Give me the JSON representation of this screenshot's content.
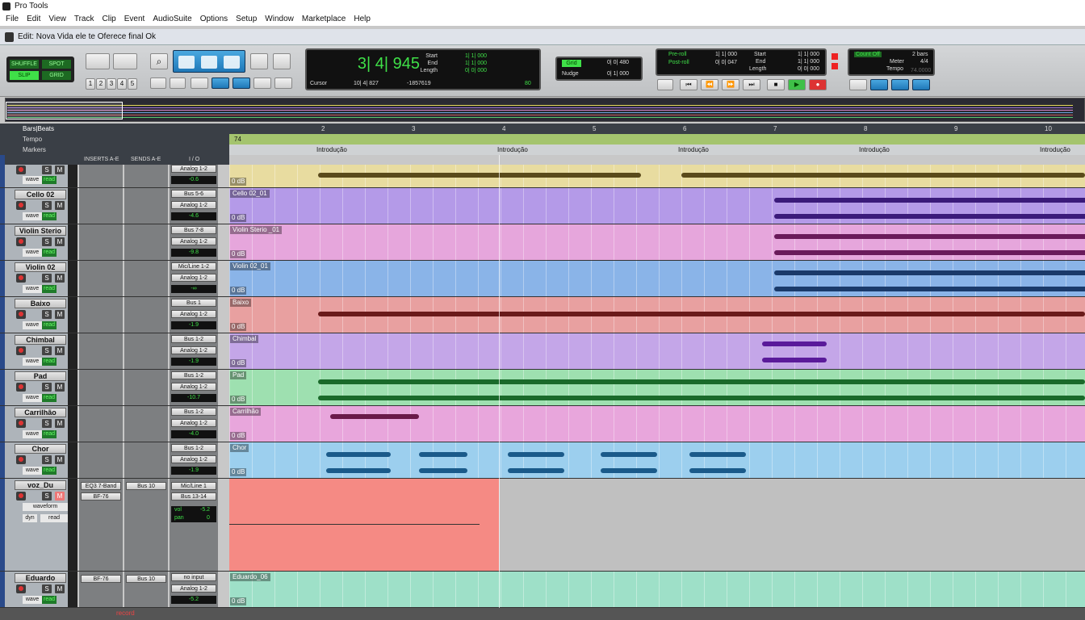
{
  "app": {
    "title": "Pro Tools"
  },
  "menu": [
    "File",
    "Edit",
    "View",
    "Track",
    "Clip",
    "Event",
    "AudioSuite",
    "Options",
    "Setup",
    "Window",
    "Marketplace",
    "Help"
  ],
  "edit_window": {
    "title": "Edit: Nova Vida ele te Oferece final  Ok"
  },
  "toolbar": {
    "modes": {
      "shuffle": "SHUFFLE",
      "spot": "SPOT",
      "slip": "SLIP",
      "grid": "GRID"
    },
    "zoom_presets": [
      "1",
      "2",
      "3",
      "4",
      "5"
    ],
    "counter": {
      "main": "3| 4| 945",
      "cursor_label": "Cursor",
      "cursor_value": "10| 4| 827",
      "sample_value": "-1857619",
      "tempo_small": "80"
    },
    "selection": {
      "start_label": "Start",
      "end_label": "End",
      "length_label": "Length",
      "start": "1| 1| 000",
      "end": "1| 1| 000",
      "length": "0| 0| 000"
    },
    "grid_nudge": {
      "grid_label": "Grid",
      "grid_value": "0| 0| 480",
      "nudge_label": "Nudge",
      "nudge_value": "0| 1| 000"
    },
    "transport": {
      "preroll_label": "Pre-roll",
      "postroll_label": "Post-roll",
      "preroll": "1| 1| 000",
      "postroll": "0| 0| 047",
      "start_label": "Start",
      "end_label": "End",
      "length_label": "Length",
      "start": "1| 1| 000",
      "end": "1| 1| 000",
      "length": "0| 0| 000"
    },
    "count": {
      "countoff_label": "Count Off",
      "countoff_value": "2 bars",
      "meter_label": "Meter",
      "meter_value": "4/4",
      "tempo_label": "Tempo",
      "tempo_value": "74.0000"
    }
  },
  "rulers": {
    "bars_label": "Bars|Beats",
    "tempo_label": "Tempo",
    "markers_label": "Markers",
    "bars": [
      "2",
      "3",
      "4",
      "5",
      "6",
      "7",
      "8",
      "9",
      "10"
    ],
    "tempo_value": "74",
    "marker_text": "Introdução"
  },
  "columns": {
    "inserts": "INSERTS A-E",
    "sends": "SENDS A-E",
    "io": "I / O"
  },
  "tracks": [
    {
      "name": "",
      "io1": "Analog 1-2",
      "vol": "-0.6",
      "clip": "",
      "vol_label": "0 dB",
      "color": "#e8dca0",
      "wave": "#5a4a1a"
    },
    {
      "name": "Cello 02",
      "io1": "Bus 5-6",
      "io2": "Analog 1-2",
      "vol": "-4.6",
      "clip": "Cello 02_01",
      "vol_label": "0 dB",
      "color": "#b49ae8",
      "wave": "#3a1a7a"
    },
    {
      "name": "Violin Sterio",
      "io1": "Bus 7-8",
      "io2": "Analog 1-2",
      "vol": "-9.8",
      "clip": "Violin Sterio _01",
      "vol_label": "0 dB",
      "color": "#e6a6dc",
      "wave": "#6a1a5a"
    },
    {
      "name": "Violin 02",
      "io1": "Mic/Line 1-2",
      "io2": "Analog 1-2",
      "vol": "-∞",
      "clip": "Violin 02_01",
      "vol_label": "0 dB",
      "color": "#8ab4e8",
      "wave": "#1a3a6a"
    },
    {
      "name": "Baixo",
      "io1": "Bus 1",
      "io2": "Analog 1-2",
      "vol": "-1.9",
      "clip": "Baixo",
      "vol_label": "0 dB",
      "color": "#e8a0a0",
      "wave": "#6a1a1a"
    },
    {
      "name": "Chimbal",
      "io1": "Bus 1-2",
      "io2": "Analog 1-2",
      "vol": "-1.9",
      "clip": "Chimbal",
      "vol_label": "0 dB",
      "color": "#c4a6e8",
      "wave": "#5a1a9a"
    },
    {
      "name": "Pad",
      "io1": "Bus 1-2",
      "io2": "Analog 1-2",
      "vol": "-10.7",
      "clip": "Pad",
      "vol_label": "0 dB",
      "color": "#9ee0b0",
      "wave": "#1a6a2a"
    },
    {
      "name": "Carrilhão",
      "io1": "Bus 1-2",
      "io2": "Analog 1-2",
      "vol": "-4.0",
      "clip": "Carrilhão",
      "vol_label": "0 dB",
      "color": "#e8a6dc",
      "wave": "#6a1a4a"
    },
    {
      "name": "Chor",
      "io1": "Bus 1-2",
      "io2": "Analog 1-2",
      "vol": "-1.9",
      "clip": "Chor",
      "vol_label": "0 dB",
      "color": "#9ccfee",
      "wave": "#1a5a8a"
    },
    {
      "name": "voz_Du",
      "io1": "Mic/Line 1",
      "io2": "Bus 13-14",
      "insert": "EQ3 7-Band",
      "insert2": "BF-76",
      "send": "Bus 10",
      "vol_lbl": "vol",
      "vol": "-5.2",
      "pan_lbl": "pan",
      "pan": "0",
      "view": "waveform",
      "dyn": "dyn",
      "read": "read",
      "color": "#f58a84"
    },
    {
      "name": "Eduardo",
      "io1": "no input",
      "io2": "Analog 1-2",
      "insert": "BF-76",
      "send": "Bus 10",
      "vol": "-5.2",
      "clip": "Eduardo_06",
      "vol_label": "0 dB",
      "color": "#9ee0c8",
      "wave": "#1a6a5a"
    }
  ],
  "common": {
    "solo": "S",
    "mute": "M",
    "wave": "wave",
    "read": "read",
    "bottom_record": "record"
  }
}
